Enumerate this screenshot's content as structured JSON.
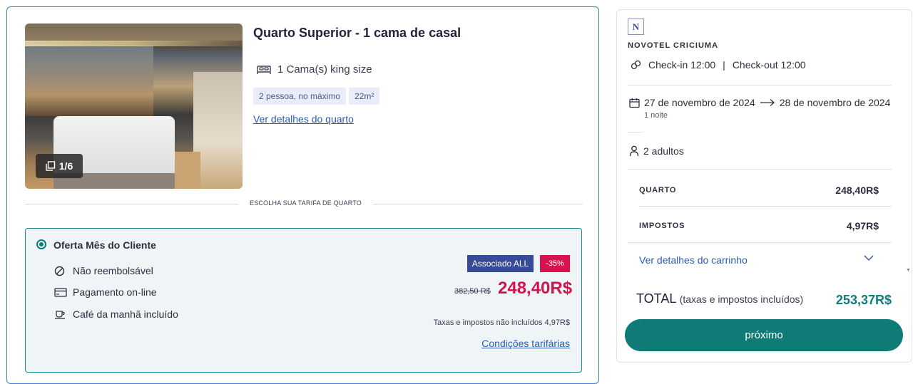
{
  "room": {
    "title": "Quarto Superior - 1 cama de casal",
    "bed": "1 Cama(s) king size",
    "chips": [
      "2 pessoa, no máximo",
      "22m²"
    ],
    "details_link": "Ver detalhes do quarto",
    "photo_counter": "1/6"
  },
  "rate_section": {
    "label": "ESCOLHA SUA TARIFA DE QUARTO"
  },
  "offer": {
    "title": "Oferta Mês do Cliente",
    "selected": true,
    "features": [
      {
        "icon": "prohibited-icon",
        "text": "Não reembolsável"
      },
      {
        "icon": "credit-card-icon",
        "text": "Pagamento on-line"
      },
      {
        "icon": "coffee-cup-icon",
        "text": "Café da manhã incluído"
      }
    ],
    "badge_member": "Associado ALL",
    "badge_discount": "-35%",
    "old_price": "382,50 R$",
    "new_price": "248,40R$",
    "tax_note": "Taxas e impostos não incluídos 4,97R$",
    "conditions_link": "Condições tarifárias"
  },
  "summary": {
    "logo_letter": "N",
    "hotel_name": "NOVOTEL CRICIUMA",
    "check_in": "Check-in 12:00",
    "check_sep": "|",
    "check_out": "Check-out 12:00",
    "date_from": "27 de novembro de 2024",
    "date_to": "28 de novembro de 2024",
    "nights": "1 noite",
    "guests": "2 adultos",
    "room_label": "QUARTO",
    "room_value": "248,40R$",
    "tax_label": "IMPOSTOS",
    "tax_value": "4,97R$",
    "cart_link": "Ver detalhes do carrinho",
    "total_label": "TOTAL",
    "total_note": "(taxas e impostos incluídos)",
    "total_value": "253,37R$",
    "next_button": "próximo"
  },
  "colors": {
    "accent_teal": "#0f7b76",
    "price_red": "#d3134d",
    "member_blue": "#374a96",
    "link_blue": "#2a5bb5",
    "selected_border": "#3f7ad1"
  }
}
